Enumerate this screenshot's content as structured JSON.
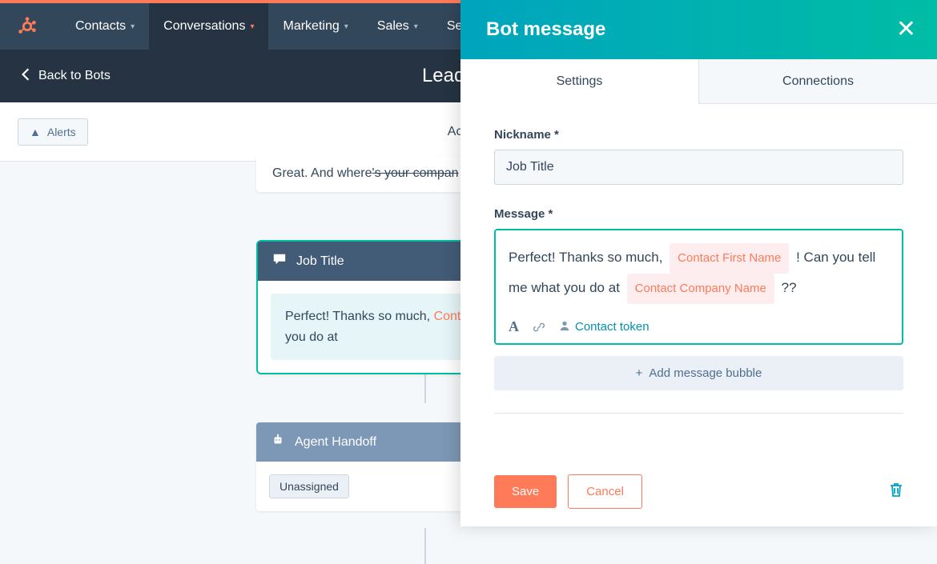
{
  "nav": {
    "items": [
      "Contacts",
      "Conversations",
      "Marketing",
      "Sales",
      "Ser"
    ],
    "active_index": 1
  },
  "subheader": {
    "back_label": "Back to Bots",
    "title": "Lead Quali"
  },
  "toolbar": {
    "alerts_label": "Alerts",
    "tab_label": "Actions"
  },
  "flow": {
    "partial_message_pre": "Great. And where",
    "partial_message_strike": "'s your compan",
    "job_title_card": {
      "header": "Job Title",
      "msg_pre": "Perfect! Thanks so much, ",
      "token": "Conta",
      "msg_post": "you do at"
    },
    "handoff_card": {
      "header": "Agent Handoff",
      "tag": "Unassigned"
    }
  },
  "panel": {
    "title": "Bot message",
    "tabs": {
      "settings": "Settings",
      "connections": "Connections"
    },
    "nickname_label": "Nickname *",
    "nickname_value": "Job Title",
    "message_label": "Message *",
    "editor": {
      "part1": "Perfect! Thanks so much,",
      "token1": "Contact First Name",
      "part2": "! Can you tell me what you do at",
      "token2": "Contact Company Name",
      "part3": "??"
    },
    "contact_token_label": "Contact token",
    "add_bubble_label": "Add message bubble",
    "save_label": "Save",
    "cancel_label": "Cancel"
  }
}
